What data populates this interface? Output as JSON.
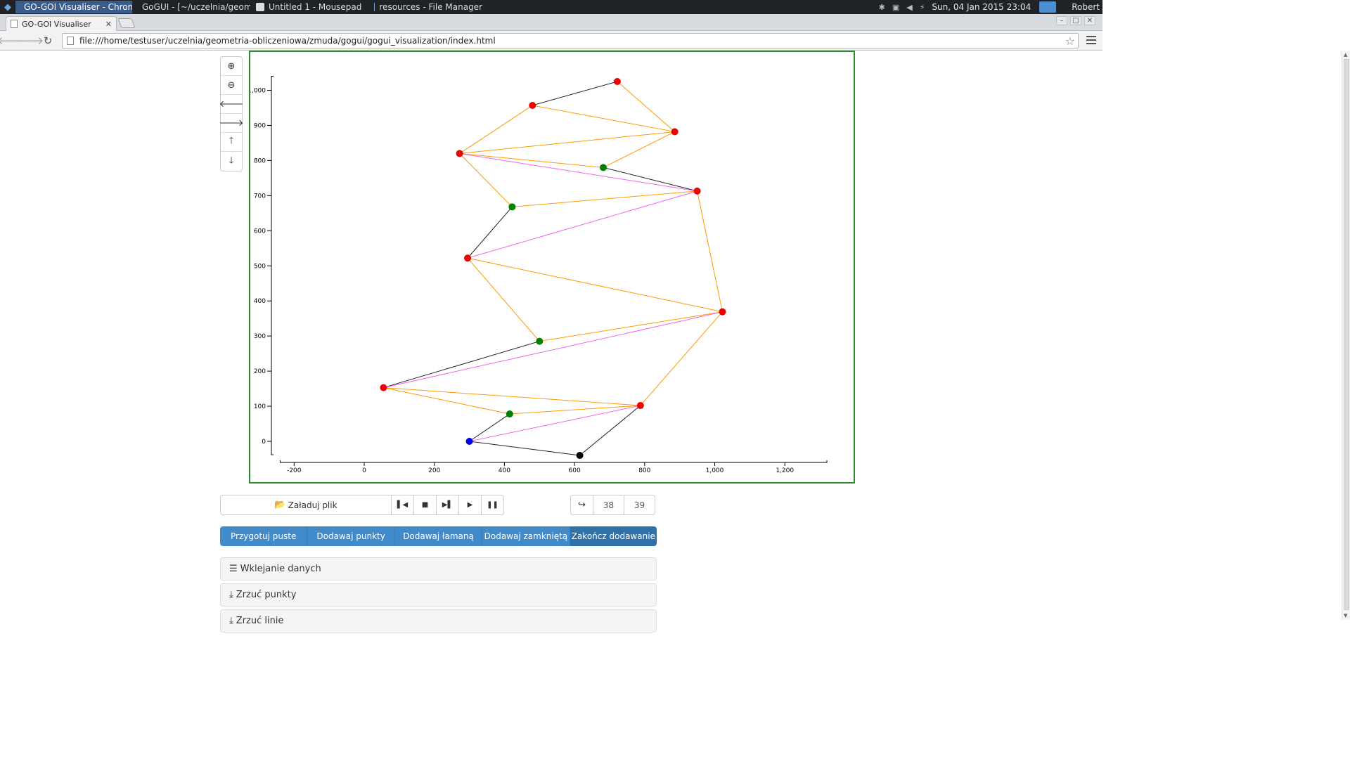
{
  "taskbar": {
    "tasks": [
      {
        "label": "GO-GOI Visualiser - Chrom...",
        "active": true
      },
      {
        "label": "GoGUI - [~/uczelnia/geom...",
        "active": false
      },
      {
        "label": "Untitled 1 - Mousepad",
        "active": false
      },
      {
        "label": "resources - File Manager",
        "active": false
      }
    ],
    "clock": "Sun, 04 Jan 2015 23:04",
    "user": "Robert"
  },
  "browser": {
    "tab_title": "GO-GOI Visualiser",
    "url": "file:///home/testuser/uczelnia/geometria-obliczeniowa/zmuda/gogui/gogui_visualization/index.html"
  },
  "chart_data": {
    "type": "scatter",
    "title": "",
    "xlabel": "",
    "ylabel": "",
    "xlim": [
      -240,
      1320
    ],
    "ylim": [
      -40,
      1030
    ],
    "xticks": [
      -200,
      0,
      200,
      400,
      600,
      800,
      1000,
      1200
    ],
    "yticks": [
      0,
      100,
      200,
      300,
      400,
      500,
      600,
      700,
      800,
      900,
      1000
    ],
    "tick_labels_x": [
      "-200",
      "0",
      "200",
      "400",
      "600",
      "800",
      "1,000",
      "1,200"
    ],
    "tick_labels_y": [
      "0",
      "100",
      "200",
      "300",
      "400",
      "500",
      "600",
      "700",
      "800",
      "900",
      "1,000"
    ],
    "points": [
      {
        "id": "p0",
        "x": 300,
        "y": 0,
        "color": "#0000ee"
      },
      {
        "id": "p1",
        "x": 415,
        "y": 78,
        "color": "#008000"
      },
      {
        "id": "p2",
        "x": 55,
        "y": 153,
        "color": "#ee0000"
      },
      {
        "id": "p3",
        "x": 500,
        "y": 285,
        "color": "#008000"
      },
      {
        "id": "p4",
        "x": 295,
        "y": 522,
        "color": "#ee0000"
      },
      {
        "id": "p5",
        "x": 422,
        "y": 668,
        "color": "#008000"
      },
      {
        "id": "p6",
        "x": 272,
        "y": 820,
        "color": "#ee0000"
      },
      {
        "id": "p7",
        "x": 480,
        "y": 957,
        "color": "#ee0000"
      },
      {
        "id": "p8",
        "x": 722,
        "y": 1025,
        "color": "#ee0000"
      },
      {
        "id": "p9",
        "x": 886,
        "y": 882,
        "color": "#ee0000"
      },
      {
        "id": "p10",
        "x": 682,
        "y": 780,
        "color": "#008000"
      },
      {
        "id": "p11",
        "x": 950,
        "y": 713,
        "color": "#ee0000"
      },
      {
        "id": "p12",
        "x": 1022,
        "y": 369,
        "color": "#ee0000"
      },
      {
        "id": "p13",
        "x": 788,
        "y": 102,
        "color": "#ee0000"
      },
      {
        "id": "p14",
        "x": 615,
        "y": -40,
        "color": "#000000"
      }
    ],
    "series": [
      {
        "color": "#222222",
        "segments": [
          [
            "p0",
            "p14"
          ],
          [
            "p14",
            "p13"
          ],
          [
            "p0",
            "p1"
          ],
          [
            "p2",
            "p3"
          ],
          [
            "p4",
            "p5"
          ],
          [
            "p7",
            "p8"
          ],
          [
            "p10",
            "p11"
          ]
        ]
      },
      {
        "color": "#ff9900",
        "segments": [
          [
            "p1",
            "p13"
          ],
          [
            "p2",
            "p13"
          ],
          [
            "p13",
            "p12"
          ],
          [
            "p3",
            "p12"
          ],
          [
            "p4",
            "p12"
          ],
          [
            "p11",
            "p12"
          ],
          [
            "p4",
            "p3"
          ],
          [
            "p5",
            "p11"
          ],
          [
            "p6",
            "p5"
          ],
          [
            "p6",
            "p10"
          ],
          [
            "p6",
            "p9"
          ],
          [
            "p10",
            "p9"
          ],
          [
            "p7",
            "p9"
          ],
          [
            "p8",
            "p9"
          ],
          [
            "p6",
            "p7"
          ],
          [
            "p2",
            "p1"
          ]
        ]
      },
      {
        "color": "#ee66ee",
        "segments": [
          [
            "p0",
            "p13"
          ],
          [
            "p2",
            "p12"
          ],
          [
            "p4",
            "p11"
          ],
          [
            "p6",
            "p11"
          ]
        ]
      }
    ]
  },
  "controls": {
    "load_label": "Załaduj plik",
    "step_from": "38",
    "step_to": "39"
  },
  "actions": {
    "prepare": "Przygotuj puste",
    "add_points": "Dodawaj punkty",
    "add_polyline": "Dodawaj łamaną",
    "add_closed": "Dodawaj zamkniętą",
    "finish": "Zakończ dodawanie"
  },
  "panels": {
    "paste": "Wklejanie danych",
    "dump_points": "Zrzuć punkty",
    "dump_lines": "Zrzuć linie"
  }
}
